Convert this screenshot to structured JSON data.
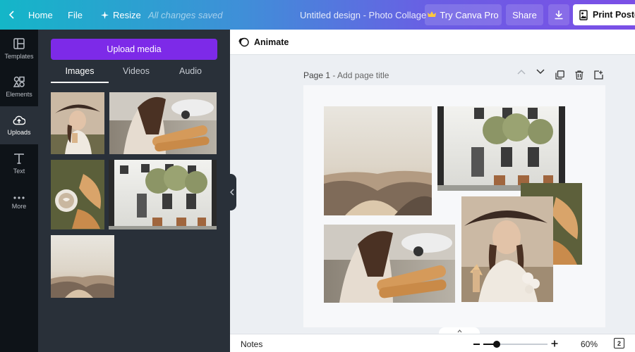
{
  "topbar": {
    "home_label": "Home",
    "file_label": "File",
    "resize_label": "Resize",
    "saved_status": "All changes saved",
    "document_title": "Untitled design - Photo Collage",
    "try_pro_label": "Try Canva Pro",
    "share_label": "Share",
    "print_label": "Print Poster"
  },
  "rail": {
    "items": [
      {
        "label": "Templates",
        "icon": "templates-icon"
      },
      {
        "label": "Elements",
        "icon": "elements-icon"
      },
      {
        "label": "Uploads",
        "icon": "uploads-icon"
      },
      {
        "label": "Text",
        "icon": "text-icon"
      },
      {
        "label": "More",
        "icon": "more-icon"
      }
    ],
    "active": "Uploads"
  },
  "panel": {
    "upload_button": "Upload media",
    "tabs": [
      "Images",
      "Videos",
      "Audio"
    ],
    "active_tab": "Images"
  },
  "toolbar": {
    "animate_label": "Animate"
  },
  "page": {
    "number_label": "Page 1",
    "title_placeholder": " - Add page title"
  },
  "bottom": {
    "notes_label": "Notes",
    "zoom": "60%",
    "zoom_fraction": 0.6,
    "page_count": "2"
  },
  "colors": {
    "accent_purple": "#7d2ae8",
    "rail_bg": "#0e1318",
    "panel_bg": "#293039"
  }
}
